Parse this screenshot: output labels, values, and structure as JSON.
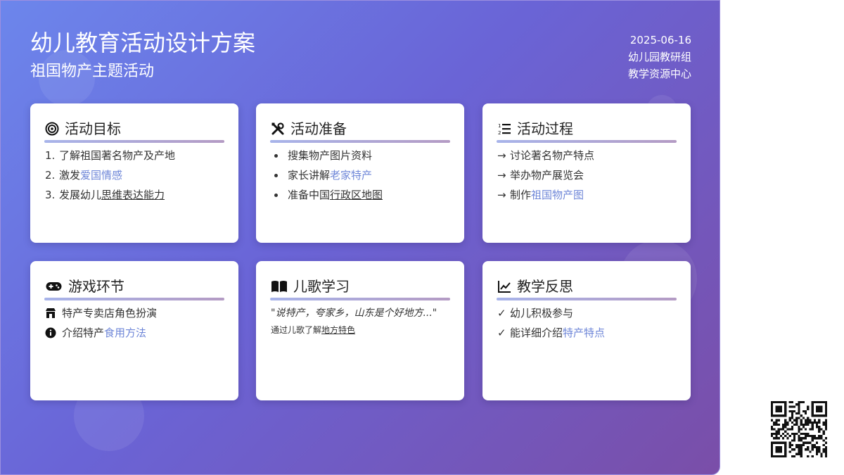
{
  "header": {
    "title": "幼儿教育活动设计方案",
    "subtitle": "祖国物产主题活动",
    "date": "2025-06-16",
    "org": "幼儿园教研组",
    "center": "教学资源中心"
  },
  "colors": {
    "accent": "#6f87d8",
    "gradient_start": "#6c86ec",
    "gradient_end": "#7a4ea8"
  },
  "cards": {
    "goals": {
      "icon": "target-icon",
      "title": "活动目标",
      "items": [
        {
          "num": "1.",
          "text": "了解祖国著名物产及产地"
        },
        {
          "num": "2.",
          "text": "激发",
          "hl": "爱国情感"
        },
        {
          "num": "3.",
          "text": "发展幼儿",
          "ul": "思维表达能力"
        }
      ]
    },
    "prep": {
      "icon": "tools-icon",
      "title": "活动准备",
      "items": [
        {
          "text": "搜集物产图片资料"
        },
        {
          "text": "家长讲解",
          "hl": "老家特产"
        },
        {
          "text": "准备中国",
          "ul": "行政区地图"
        }
      ]
    },
    "process": {
      "icon": "ordered-list-icon",
      "title": "活动过程",
      "items": [
        {
          "mark": "→",
          "text": "讨论著名物产特点"
        },
        {
          "mark": "→",
          "text": "举办物产展览会"
        },
        {
          "mark": "→",
          "text": "制作",
          "hl": "祖国物产图"
        }
      ]
    },
    "game": {
      "icon": "gamepad-icon",
      "title": "游戏环节",
      "items": [
        {
          "icon": "store-icon",
          "text": "特产专卖店角色扮演"
        },
        {
          "icon": "info-icon",
          "text": "介绍特产",
          "hl": "食用方法"
        }
      ]
    },
    "song": {
      "icon": "book-icon",
      "title": "儿歌学习",
      "quote": "\"说特产，夸家乡，山东是个好地方...\"",
      "note_prefix": "通过儿歌了解",
      "note_ul": "地方特色"
    },
    "reflection": {
      "icon": "chart-line-icon",
      "title": "教学反思",
      "items": [
        {
          "mark": "✓",
          "text": "幼儿积极参与"
        },
        {
          "mark": "✓",
          "text": "能详细介绍",
          "hl": "特产特点"
        }
      ]
    }
  },
  "qr": {
    "icon": "qr-code-icon"
  }
}
